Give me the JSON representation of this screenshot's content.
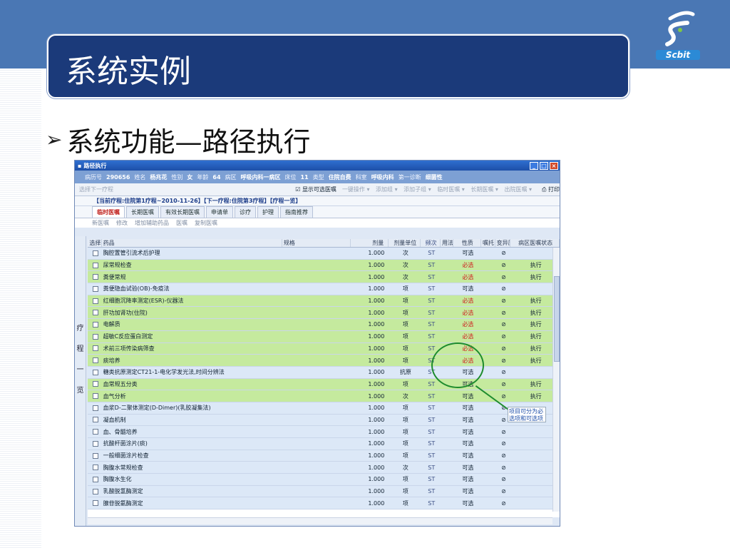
{
  "slide": {
    "title": "系统实例",
    "bullet": "系统功能—路径执行",
    "logo_text": "Scbit"
  },
  "window": {
    "title": "路径执行",
    "patient_bar": [
      "病历号",
      "290656",
      "姓名",
      "杨兆花",
      "性别",
      "女",
      "年龄",
      "64",
      "病区",
      "呼吸内科一病区",
      "床位",
      "11",
      "类型",
      "住院自费",
      "科室",
      "呼吸内科",
      "第一诊断",
      "细菌性"
    ],
    "toolbar": {
      "left": "选择下一疗程",
      "show_optional": "显示可选医嘱",
      "items": [
        "一键操作",
        "添加组",
        "添加子组",
        "临时医嘱",
        "长期医嘱",
        "出院医嘱"
      ],
      "print": "打印"
    },
    "path_info": "【当前疗程:住院第1疗程~2010-11-26】【下一疗程:住院第3疗程】【疗程一览】",
    "tabs": [
      "临时医嘱",
      "长期医嘱",
      "有效长期医嘱",
      "申请单",
      "诊疗",
      "护理",
      "指南推荐"
    ],
    "sub_tools": [
      "新医嘱",
      "修改",
      "增加辅助药品",
      "医嘱",
      "复制医嘱"
    ],
    "side_label": [
      "疗",
      "程",
      "一",
      "览"
    ],
    "columns": [
      "选择",
      "药品",
      "规格",
      "剂量",
      "剂量单位",
      "频次",
      "用法",
      "性质",
      "嘱托",
      "变异原因",
      "病区医嘱状态"
    ],
    "rows": [
      {
        "name": "胸腔置管引流术后护理",
        "dose": "1.000",
        "unit": "次",
        "freq": "ST",
        "nature": "可选",
        "status": "",
        "green": false
      },
      {
        "name": "尿常规检查",
        "dose": "1.000",
        "unit": "次",
        "freq": "ST",
        "nature": "必选",
        "status": "执行",
        "green": true
      },
      {
        "name": "粪便常规",
        "dose": "1.000",
        "unit": "次",
        "freq": "ST",
        "nature": "必选",
        "status": "执行",
        "green": true
      },
      {
        "name": "粪便隐血试验(OB)-免疫法",
        "dose": "1.000",
        "unit": "项",
        "freq": "ST",
        "nature": "可选",
        "status": "",
        "green": false
      },
      {
        "name": "红细胞沉降率测定(ESR)-仪器法",
        "dose": "1.000",
        "unit": "项",
        "freq": "ST",
        "nature": "必选",
        "status": "执行",
        "green": true
      },
      {
        "name": "肝功加肾功(住院)",
        "dose": "1.000",
        "unit": "项",
        "freq": "ST",
        "nature": "必选",
        "status": "执行",
        "green": true
      },
      {
        "name": "电解质",
        "dose": "1.000",
        "unit": "项",
        "freq": "ST",
        "nature": "必选",
        "status": "执行",
        "green": true
      },
      {
        "name": "超敏C反应蛋白测定",
        "dose": "1.000",
        "unit": "项",
        "freq": "ST",
        "nature": "必选",
        "status": "执行",
        "green": true
      },
      {
        "name": "术前三项传染病筛查",
        "dose": "1.000",
        "unit": "项",
        "freq": "ST",
        "nature": "必选",
        "status": "执行",
        "green": true
      },
      {
        "name": "痰培养",
        "dose": "1.000",
        "unit": "项",
        "freq": "ST",
        "nature": "必选",
        "status": "执行",
        "green": true
      },
      {
        "name": "糖类抗原测定CT21-1-电化学发光法,时间分辨法",
        "dose": "1.000",
        "unit": "抗原",
        "freq": "ST",
        "nature": "可选",
        "status": "",
        "green": false
      },
      {
        "name": "血常规五分类",
        "dose": "1.000",
        "unit": "项",
        "freq": "ST",
        "nature": "可选",
        "status": "执行",
        "green": true
      },
      {
        "name": "血气分析",
        "dose": "1.000",
        "unit": "次",
        "freq": "ST",
        "nature": "可选",
        "status": "执行",
        "green": true
      },
      {
        "name": "血浆D-二聚体测定(D-Dimer)(乳胶凝集法)",
        "dose": "1.000",
        "unit": "项",
        "freq": "ST",
        "nature": "可选",
        "status": "",
        "green": false
      },
      {
        "name": "凝血机制",
        "dose": "1.000",
        "unit": "项",
        "freq": "ST",
        "nature": "可选",
        "status": "",
        "green": false
      },
      {
        "name": "血、骨髓培养",
        "dose": "1.000",
        "unit": "项",
        "freq": "ST",
        "nature": "可选",
        "status": "",
        "green": false
      },
      {
        "name": "抗酸杆菌涂片(痰)",
        "dose": "1.000",
        "unit": "项",
        "freq": "ST",
        "nature": "可选",
        "status": "",
        "green": false
      },
      {
        "name": "一般细菌涂片检查",
        "dose": "1.000",
        "unit": "项",
        "freq": "ST",
        "nature": "可选",
        "status": "",
        "green": false
      },
      {
        "name": "胸腹水常规检查",
        "dose": "1.000",
        "unit": "次",
        "freq": "ST",
        "nature": "可选",
        "status": "",
        "green": false
      },
      {
        "name": "胸腹水生化",
        "dose": "1.000",
        "unit": "项",
        "freq": "ST",
        "nature": "可选",
        "status": "",
        "green": false
      },
      {
        "name": "乳酸脱氢酶测定",
        "dose": "1.000",
        "unit": "项",
        "freq": "ST",
        "nature": "可选",
        "status": "",
        "green": false
      },
      {
        "name": "腺苷脱氨酶测定",
        "dose": "1.000",
        "unit": "项",
        "freq": "ST",
        "nature": "可选",
        "status": "",
        "green": false
      }
    ],
    "callout": "项目可分为必选项和可选项"
  },
  "colors": {
    "header_blue": "#4a77b4",
    "title_navy": "#1b3a7a",
    "row_green": "#c5ea9e",
    "row_blue": "#dce8f7",
    "required_red": "#d02020",
    "annotation_green": "#1e8c2e"
  }
}
